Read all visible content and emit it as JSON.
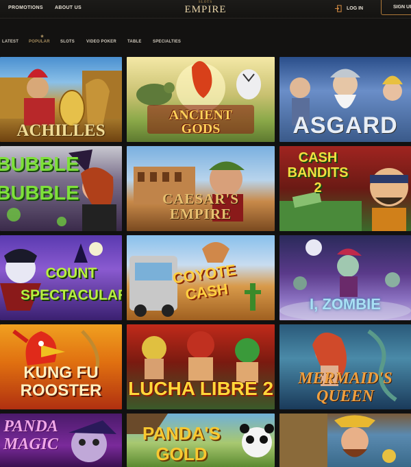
{
  "header": {
    "nav": [
      "PROMOTIONS",
      "ABOUT US"
    ],
    "logo_small": "SLOTS",
    "logo_main": "EMPIRE",
    "login_label": "LOG IN",
    "signup_label": "SIGN UP"
  },
  "categories": {
    "items": [
      "LATEST",
      "POPULAR",
      "SLOTS",
      "VIDEO POKER",
      "TABLE",
      "SPECIALTIES"
    ],
    "active": "POPULAR"
  },
  "games": [
    {
      "title": "ACHILLES"
    },
    {
      "title": "ANCIENT GODS"
    },
    {
      "title": "ASGARD"
    },
    {
      "title": "BUBBLE BUBBLE"
    },
    {
      "title": "CAESAR'S EMPIRE"
    },
    {
      "title": "CASH BANDITS 2"
    },
    {
      "title": "COUNT SPECTACULAR"
    },
    {
      "title": "COYOTE CASH"
    },
    {
      "title": "I, ZOMBIE"
    },
    {
      "title": "KUNG FU ROOSTER"
    },
    {
      "title": "LUCHA LIBRE 2"
    },
    {
      "title": "MERMAID'S QUEEN"
    },
    {
      "title": "PANDA MAGIC"
    },
    {
      "title": "PANDA'S GOLD"
    },
    {
      "title": ""
    }
  ],
  "colors": {
    "background": "#111111",
    "accent": "#b07a3a",
    "active_tab": "#a58c5e"
  }
}
